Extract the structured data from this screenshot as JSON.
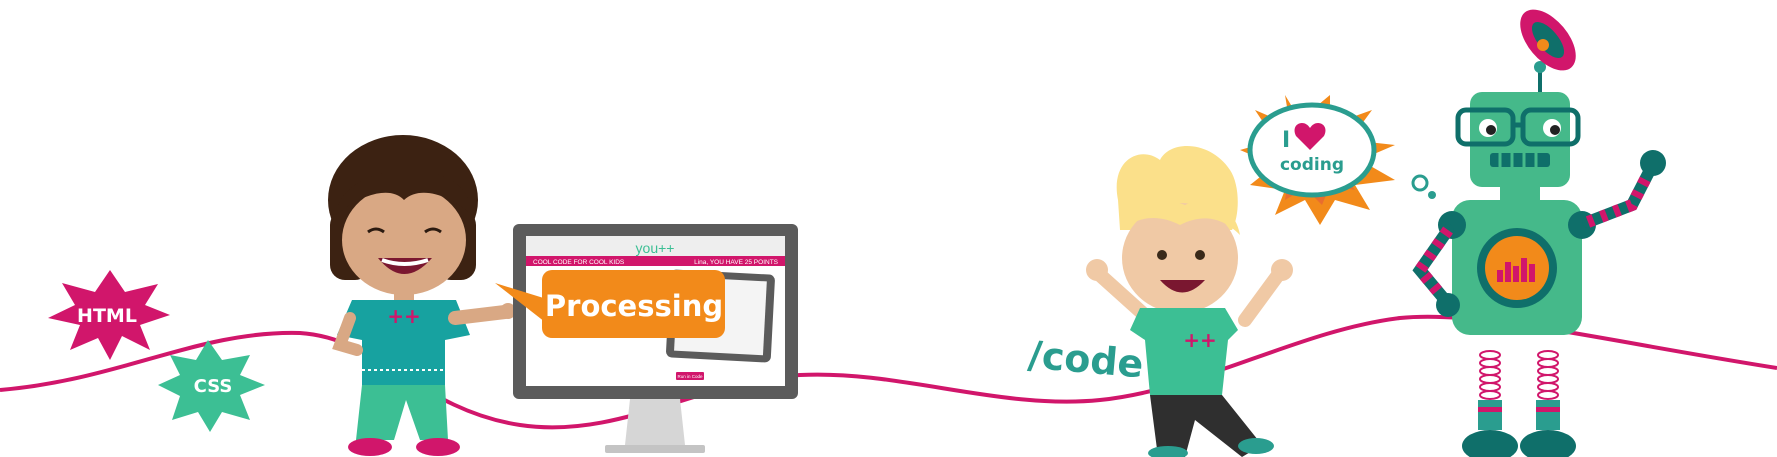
{
  "badges": {
    "html": "HTML",
    "css": "CSS"
  },
  "speech_bubble": "Processing",
  "monitor": {
    "logo": "you++",
    "nav_left": "COOL CODE FOR COOL KIDS",
    "nav_right": "Lina, YOU HAVE 25 POINTS",
    "button": "Run in Code"
  },
  "kids": {
    "girl_shirt_text": "++",
    "boy_shirt_text": "++"
  },
  "code_label": "/code",
  "robot_thought": {
    "line1": "I",
    "line2": "coding"
  },
  "colors": {
    "magenta": "#d1166b",
    "teal": "#2a9d8f",
    "mint": "#3cbf94",
    "orange": "#f28a1a",
    "robot_green": "#45b98a",
    "dark_teal": "#0f6f6a"
  }
}
